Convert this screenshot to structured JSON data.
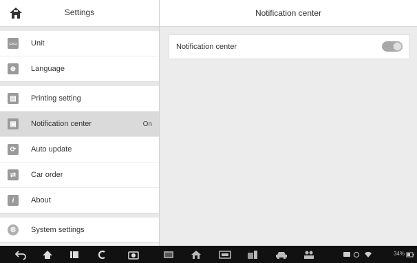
{
  "settings_panel": {
    "title": "Settings",
    "items": [
      {
        "label": "Unit",
        "icon": "unit-icon",
        "value": ""
      },
      {
        "label": "Language",
        "icon": "language-icon",
        "value": ""
      },
      {
        "label": "Printing setting",
        "icon": "printer-icon",
        "value": ""
      },
      {
        "label": "Notification center",
        "icon": "notification-icon",
        "value": "On"
      },
      {
        "label": "Auto update",
        "icon": "auto-update-icon",
        "value": ""
      },
      {
        "label": "Car order",
        "icon": "car-order-icon",
        "value": ""
      },
      {
        "label": "About",
        "icon": "info-icon",
        "value": ""
      },
      {
        "label": "System settings",
        "icon": "gear-icon",
        "value": ""
      }
    ]
  },
  "detail_panel": {
    "title": "Notification center",
    "option_label": "Notification center",
    "toggle_on": true
  },
  "colors": {
    "panel_bg": "#f3f3f3",
    "active_row": "#dadada",
    "navbar": "#111111",
    "icon_gray": "#9a9a9a"
  },
  "navbar": {
    "icons": [
      "back-icon",
      "home-icon",
      "recent-apps-icon",
      "browser-icon",
      "camera-icon",
      "screen-icon",
      "home-house-icon",
      "vci-icon",
      "data-manager-icon",
      "car-icon",
      "remote-icon",
      "message-icon",
      "settings-small-icon",
      "wifi-icon",
      "battery-icon"
    ],
    "status_text": "34%"
  }
}
